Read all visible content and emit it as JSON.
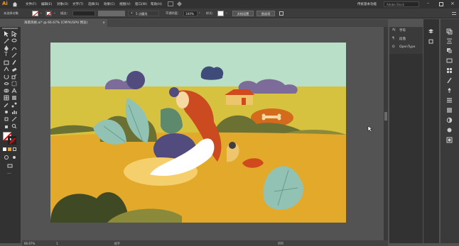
{
  "app": {
    "logo": "Ai",
    "workspace": "传统基本功能",
    "search_placeholder": "Adobe Stock"
  },
  "menu": [
    "文件(F)",
    "编辑(E)",
    "对象(O)",
    "文字(T)",
    "选择(S)",
    "效果(C)",
    "视图(V)",
    "窗口(W)",
    "帮助(H)"
  ],
  "control": {
    "selection": "未选择对象",
    "stroke_label": "描边：",
    "brush": "5 点圆形",
    "opacity_label": "不透明度：",
    "opacity": "100%",
    "style_label": "样式：",
    "doc_setup": "文档设置",
    "prefs": "首选项"
  },
  "document_tab": "海景风格.ai* @ 66.67% (CMYK/GPU 预览)",
  "status": {
    "zoom": "66.67%",
    "page": "1",
    "tool": "抓手"
  },
  "panel": {
    "items": [
      "字符",
      "段落",
      "OpenType"
    ]
  },
  "colors": {
    "accent": "#ff9a00",
    "sky": "#b9dfc8",
    "field": "#e3a92b"
  }
}
